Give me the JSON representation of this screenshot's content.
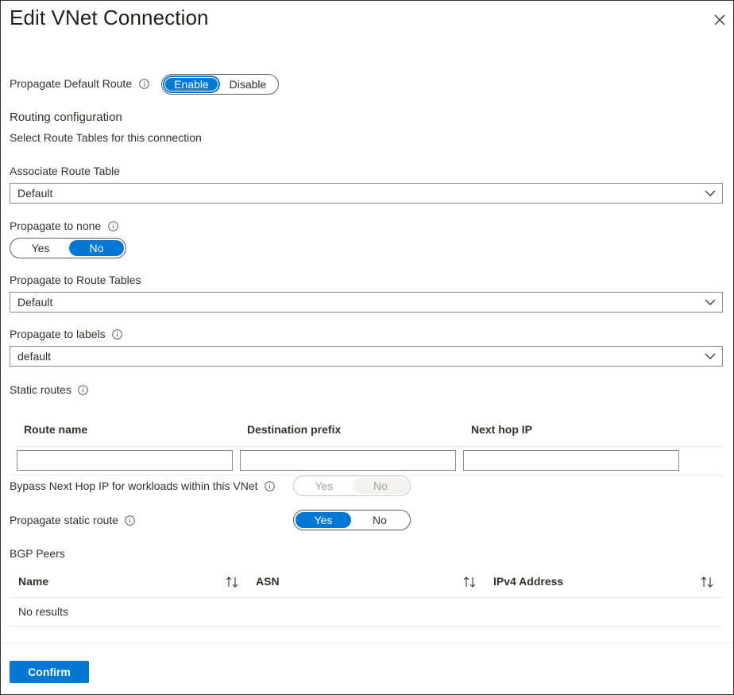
{
  "header": {
    "title": "Edit VNet Connection"
  },
  "propagate_default_route": {
    "label": "Propagate Default Route",
    "options": [
      "Enable",
      "Disable"
    ],
    "selected": "Enable"
  },
  "routing": {
    "heading": "Routing configuration",
    "subheading": "Select Route Tables for this connection"
  },
  "associate_route_table": {
    "label": "Associate Route Table",
    "value": "Default"
  },
  "propagate_to_none": {
    "label": "Propagate to none",
    "options": [
      "Yes",
      "No"
    ],
    "selected": "No"
  },
  "propagate_to_route_tables": {
    "label": "Propagate to Route Tables",
    "value": "Default"
  },
  "propagate_to_labels": {
    "label": "Propagate to labels",
    "value": "default"
  },
  "static_routes": {
    "label": "Static routes",
    "columns": [
      "Route name",
      "Destination prefix",
      "Next hop IP"
    ],
    "row": {
      "route_name": "",
      "destination_prefix": "",
      "next_hop_ip": ""
    }
  },
  "bypass_next_hop": {
    "label": "Bypass Next Hop IP for workloads within this VNet",
    "options": [
      "Yes",
      "No"
    ],
    "selected": "No",
    "disabled": true
  },
  "propagate_static_route": {
    "label": "Propagate static route",
    "options": [
      "Yes",
      "No"
    ],
    "selected": "Yes"
  },
  "bgp_peers": {
    "label": "BGP Peers",
    "columns": [
      "Name",
      "ASN",
      "IPv4 Address"
    ],
    "empty_text": "No results"
  },
  "footer": {
    "confirm_label": "Confirm"
  },
  "colors": {
    "accent": "#0078d4",
    "text": "#323130",
    "border": "#8a8886"
  },
  "icons": {
    "close": "close-icon",
    "info": "info-icon",
    "chevron": "chevron-down-icon",
    "sort": "sort-icon"
  }
}
